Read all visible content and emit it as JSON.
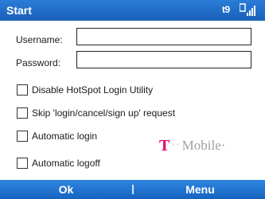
{
  "title_bar": {
    "title": "Start",
    "data_indicator": "t9",
    "signal_icon": "signal-strength-icon"
  },
  "form": {
    "username_label": "Username:",
    "username_value": "",
    "password_label": "Password:",
    "password_value": ""
  },
  "options": [
    {
      "label": "Disable HotSpot Login Utility",
      "checked": false
    },
    {
      "label": "Skip 'login/cancel/sign up' request",
      "checked": false
    },
    {
      "label": "Automatic login",
      "checked": false
    },
    {
      "label": "Automatic logoff",
      "checked": false
    }
  ],
  "brand": {
    "t": "T",
    "dots": "··",
    "word": "Mobile·",
    "color": "#e20074"
  },
  "softkeys": {
    "left": "Ok",
    "right": "Menu"
  },
  "colors": {
    "bar_blue": "#1a5fb8",
    "brand_magenta": "#e20074"
  }
}
